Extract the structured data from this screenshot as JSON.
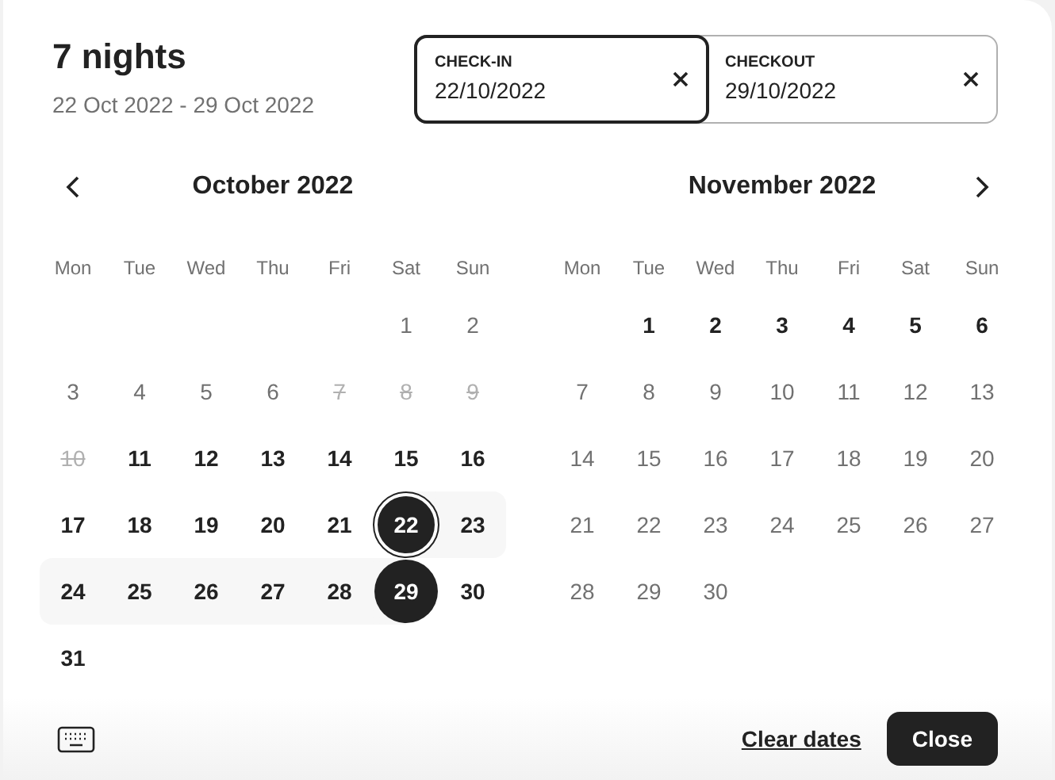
{
  "header": {
    "title": "7 nights",
    "subtitle": "22 Oct 2022 - 29 Oct 2022"
  },
  "fields": [
    {
      "label": "CHECK-IN",
      "value": "22/10/2022",
      "selected": true
    },
    {
      "label": "CHECKOUT",
      "value": "29/10/2022",
      "selected": false
    }
  ],
  "months": [
    {
      "title": "October 2022",
      "kind": "prev",
      "weekdays": [
        "Mon",
        "Tue",
        "Wed",
        "Thu",
        "Fri",
        "Sat",
        "Sun"
      ],
      "weeks": [
        [
          {
            "kind": "empty"
          },
          {
            "kind": "empty"
          },
          {
            "kind": "empty"
          },
          {
            "kind": "empty"
          },
          {
            "kind": "empty"
          },
          {
            "label": "1",
            "kind": "unavailable"
          },
          {
            "label": "2",
            "kind": "unavailable"
          }
        ],
        [
          {
            "label": "3",
            "kind": "unavailable"
          },
          {
            "label": "4",
            "kind": "unavailable"
          },
          {
            "label": "5",
            "kind": "unavailable"
          },
          {
            "label": "6",
            "kind": "unavailable"
          },
          {
            "label": "7",
            "kind": "blocked"
          },
          {
            "label": "8",
            "kind": "blocked"
          },
          {
            "label": "9",
            "kind": "blocked"
          }
        ],
        [
          {
            "label": "10",
            "kind": "blocked"
          },
          {
            "label": "11",
            "kind": "available"
          },
          {
            "label": "12",
            "kind": "available"
          },
          {
            "label": "13",
            "kind": "available"
          },
          {
            "label": "14",
            "kind": "available"
          },
          {
            "label": "15",
            "kind": "available"
          },
          {
            "label": "16",
            "kind": "available"
          }
        ],
        [
          {
            "label": "17",
            "kind": "available"
          },
          {
            "label": "18",
            "kind": "available"
          },
          {
            "label": "19",
            "kind": "available"
          },
          {
            "label": "20",
            "kind": "available"
          },
          {
            "label": "21",
            "kind": "available"
          },
          {
            "label": "22",
            "kind": "start"
          },
          {
            "label": "23",
            "kind": "range"
          }
        ],
        [
          {
            "label": "24",
            "kind": "range"
          },
          {
            "label": "25",
            "kind": "range"
          },
          {
            "label": "26",
            "kind": "range"
          },
          {
            "label": "27",
            "kind": "range"
          },
          {
            "label": "28",
            "kind": "range"
          },
          {
            "label": "29",
            "kind": "end"
          },
          {
            "label": "30",
            "kind": "available"
          }
        ],
        [
          {
            "label": "31",
            "kind": "available"
          }
        ]
      ]
    },
    {
      "title": "November 2022",
      "kind": "next",
      "weekdays": [
        "Mon",
        "Tue",
        "Wed",
        "Thu",
        "Fri",
        "Sat",
        "Sun"
      ],
      "weeks": [
        [
          {
            "kind": "empty"
          },
          {
            "label": "1",
            "kind": "available"
          },
          {
            "label": "2",
            "kind": "available"
          },
          {
            "label": "3",
            "kind": "available"
          },
          {
            "label": "4",
            "kind": "available"
          },
          {
            "label": "5",
            "kind": "available"
          },
          {
            "label": "6",
            "kind": "available"
          }
        ],
        [
          {
            "label": "7",
            "kind": "unavailable"
          },
          {
            "label": "8",
            "kind": "unavailable"
          },
          {
            "label": "9",
            "kind": "unavailable"
          },
          {
            "label": "10",
            "kind": "unavailable"
          },
          {
            "label": "11",
            "kind": "unavailable"
          },
          {
            "label": "12",
            "kind": "unavailable"
          },
          {
            "label": "13",
            "kind": "unavailable"
          }
        ],
        [
          {
            "label": "14",
            "kind": "unavailable"
          },
          {
            "label": "15",
            "kind": "unavailable"
          },
          {
            "label": "16",
            "kind": "unavailable"
          },
          {
            "label": "17",
            "kind": "unavailable"
          },
          {
            "label": "18",
            "kind": "unavailable"
          },
          {
            "label": "19",
            "kind": "unavailable"
          },
          {
            "label": "20",
            "kind": "unavailable"
          }
        ],
        [
          {
            "label": "21",
            "kind": "unavailable"
          },
          {
            "label": "22",
            "kind": "unavailable"
          },
          {
            "label": "23",
            "kind": "unavailable"
          },
          {
            "label": "24",
            "kind": "unavailable"
          },
          {
            "label": "25",
            "kind": "unavailable"
          },
          {
            "label": "26",
            "kind": "unavailable"
          },
          {
            "label": "27",
            "kind": "unavailable"
          }
        ],
        [
          {
            "label": "28",
            "kind": "unavailable"
          },
          {
            "label": "29",
            "kind": "unavailable"
          },
          {
            "label": "30",
            "kind": "unavailable"
          }
        ]
      ]
    }
  ],
  "footer": {
    "clear": "Clear dates",
    "close": "Close"
  }
}
